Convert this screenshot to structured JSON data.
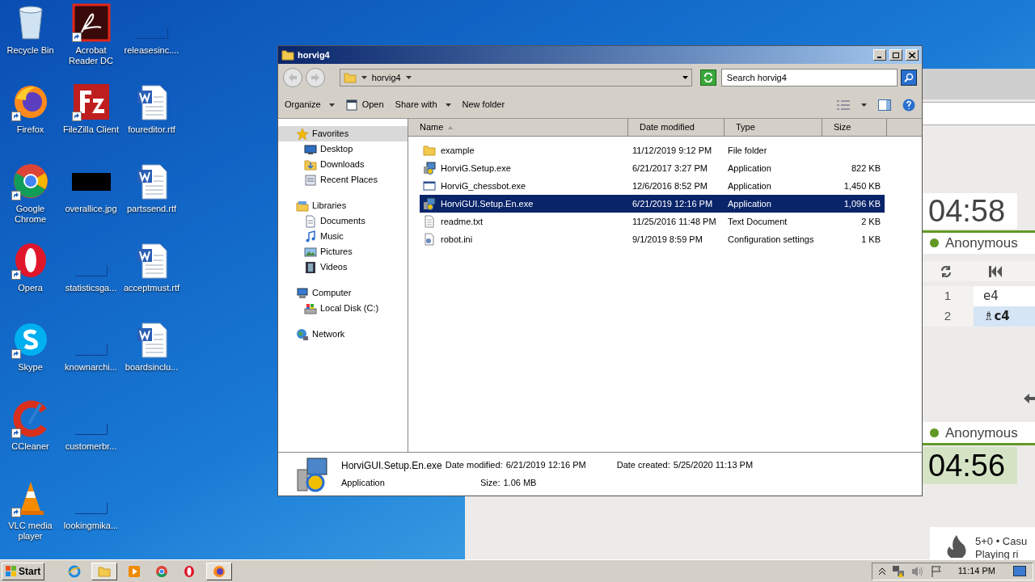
{
  "desktop": {
    "columns": [
      [
        {
          "label": "Recycle Bin",
          "kind": "recycle",
          "shortcut": false
        },
        {
          "label": "Firefox",
          "kind": "firefox",
          "shortcut": true
        },
        {
          "label": "Google Chrome",
          "kind": "chrome",
          "shortcut": true
        },
        {
          "label": "Opera",
          "kind": "opera",
          "shortcut": true
        },
        {
          "label": "Skype",
          "kind": "skype",
          "shortcut": true
        },
        {
          "label": "CCleaner",
          "kind": "ccleaner",
          "shortcut": true
        },
        {
          "label": "VLC media player",
          "kind": "vlc",
          "shortcut": true
        }
      ],
      [
        {
          "label": "Acrobat Reader DC",
          "kind": "acrobat",
          "shortcut": true
        },
        {
          "label": "FileZilla Client",
          "kind": "filezilla",
          "shortcut": true
        },
        {
          "label": "overallice.jpg",
          "kind": "image",
          "shortcut": false
        },
        {
          "label": "statisticsga...",
          "kind": "blank",
          "shortcut": false
        },
        {
          "label": "knownarchi...",
          "kind": "blank",
          "shortcut": false
        },
        {
          "label": "customerbr...",
          "kind": "blank",
          "shortcut": false
        },
        {
          "label": "lookingmika...",
          "kind": "blank",
          "shortcut": false
        }
      ],
      [
        {
          "label": "releasesinc....",
          "kind": "blank",
          "shortcut": false
        },
        {
          "label": "foureditor.rtf",
          "kind": "word",
          "shortcut": false
        },
        {
          "label": "partssend.rtf",
          "kind": "word",
          "shortcut": false
        },
        {
          "label": "acceptmust.rtf",
          "kind": "word",
          "shortcut": false
        },
        {
          "label": "boardsinclu...",
          "kind": "word",
          "shortcut": false
        }
      ]
    ]
  },
  "chess": {
    "top_player": {
      "name": "Anonymous",
      "clock": "04:58",
      "active": false
    },
    "moves": [
      {
        "number": "1",
        "move": "e4",
        "selected": false
      },
      {
        "number": "2",
        "move": "♗c4",
        "selected": true
      }
    ],
    "bottom_player": {
      "name": "Anonymous",
      "clock": "04:56",
      "active": true
    },
    "game": {
      "line_1": "5+0 • Casu",
      "line_2": "Playing ri"
    }
  },
  "explorer": {
    "title": "horvig4",
    "address": "horvig4",
    "search": {
      "placeholder": "Search horvig4"
    },
    "toolbar": [
      {
        "label": "Organize",
        "dropdown": true,
        "kind": "plain"
      },
      {
        "label": "Open",
        "dropdown": false,
        "kind": "open"
      },
      {
        "label": "Share with",
        "dropdown": true,
        "kind": "plain"
      },
      {
        "label": "New folder",
        "dropdown": false,
        "kind": "plain"
      }
    ],
    "nav": [
      {
        "label": "Favorites",
        "kind": "star",
        "selected": true,
        "children": [
          {
            "label": "Desktop",
            "kind": "desktop",
            "selected": false
          },
          {
            "label": "Downloads",
            "kind": "downloads",
            "selected": false
          },
          {
            "label": "Recent Places",
            "kind": "recent",
            "selected": false
          }
        ]
      },
      {
        "label": "Libraries",
        "kind": "library",
        "selected": false,
        "children": [
          {
            "label": "Documents",
            "kind": "document",
            "selected": false
          },
          {
            "label": "Music",
            "kind": "music",
            "selected": false
          },
          {
            "label": "Pictures",
            "kind": "pictures",
            "selected": false
          },
          {
            "label": "Videos",
            "kind": "videos",
            "selected": false
          }
        ]
      },
      {
        "label": "Computer",
        "kind": "computer",
        "selected": false,
        "children": [
          {
            "label": "Local Disk (C:)",
            "kind": "disk",
            "selected": false
          }
        ]
      },
      {
        "label": "Network",
        "kind": "network",
        "selected": false
      }
    ],
    "columns": [
      {
        "label": "Name",
        "sorted": true
      },
      {
        "label": "Date modified",
        "sorted": false
      },
      {
        "label": "Type",
        "sorted": false
      },
      {
        "label": "Size",
        "sorted": false
      }
    ],
    "files": [
      {
        "name": "example",
        "date": "11/12/2019 9:12 PM",
        "type": "File folder",
        "kind": "folder",
        "selected": false
      },
      {
        "name": "HorviG.Setup.exe",
        "date": "6/21/2017 3:27 PM",
        "type": "Application",
        "size": "822 KB",
        "kind": "installer",
        "selected": false
      },
      {
        "name": "HorviG_chessbot.exe",
        "date": "12/6/2016 8:52 PM",
        "type": "Application",
        "size": "1,450 KB",
        "kind": "window",
        "selected": false
      },
      {
        "name": "HorviGUI.Setup.En.exe",
        "date": "6/21/2019 12:16 PM",
        "type": "Application",
        "size": "1,096 KB",
        "kind": "installer",
        "selected": true
      },
      {
        "name": "readme.txt",
        "date": "11/25/2016 11:48 PM",
        "type": "Text Document",
        "size": "2 KB",
        "kind": "text",
        "selected": false
      },
      {
        "name": "robot.ini",
        "date": "9/1/2019 8:59 PM",
        "type": "Configuration settings",
        "size": "1 KB",
        "kind": "config",
        "selected": false
      }
    ],
    "details": {
      "name": "HorviGUI.Setup.En.exe",
      "type": "Application",
      "modified_label": "Date modified:",
      "modified": "6/21/2019 12:16 PM",
      "size_label": "Size:",
      "size": "1.06 MB",
      "created_label": "Date created:",
      "created": "5/25/2020 11:13 PM"
    }
  },
  "taskbar": {
    "start": "Start",
    "apps": [
      {
        "kind": "ie",
        "running": false
      },
      {
        "kind": "explorer",
        "running": true
      },
      {
        "kind": "media",
        "running": false
      },
      {
        "kind": "chrome",
        "running": false
      },
      {
        "kind": "opera",
        "running": false
      },
      {
        "kind": "firefox",
        "running": true
      }
    ],
    "clock": "11:14 PM"
  }
}
